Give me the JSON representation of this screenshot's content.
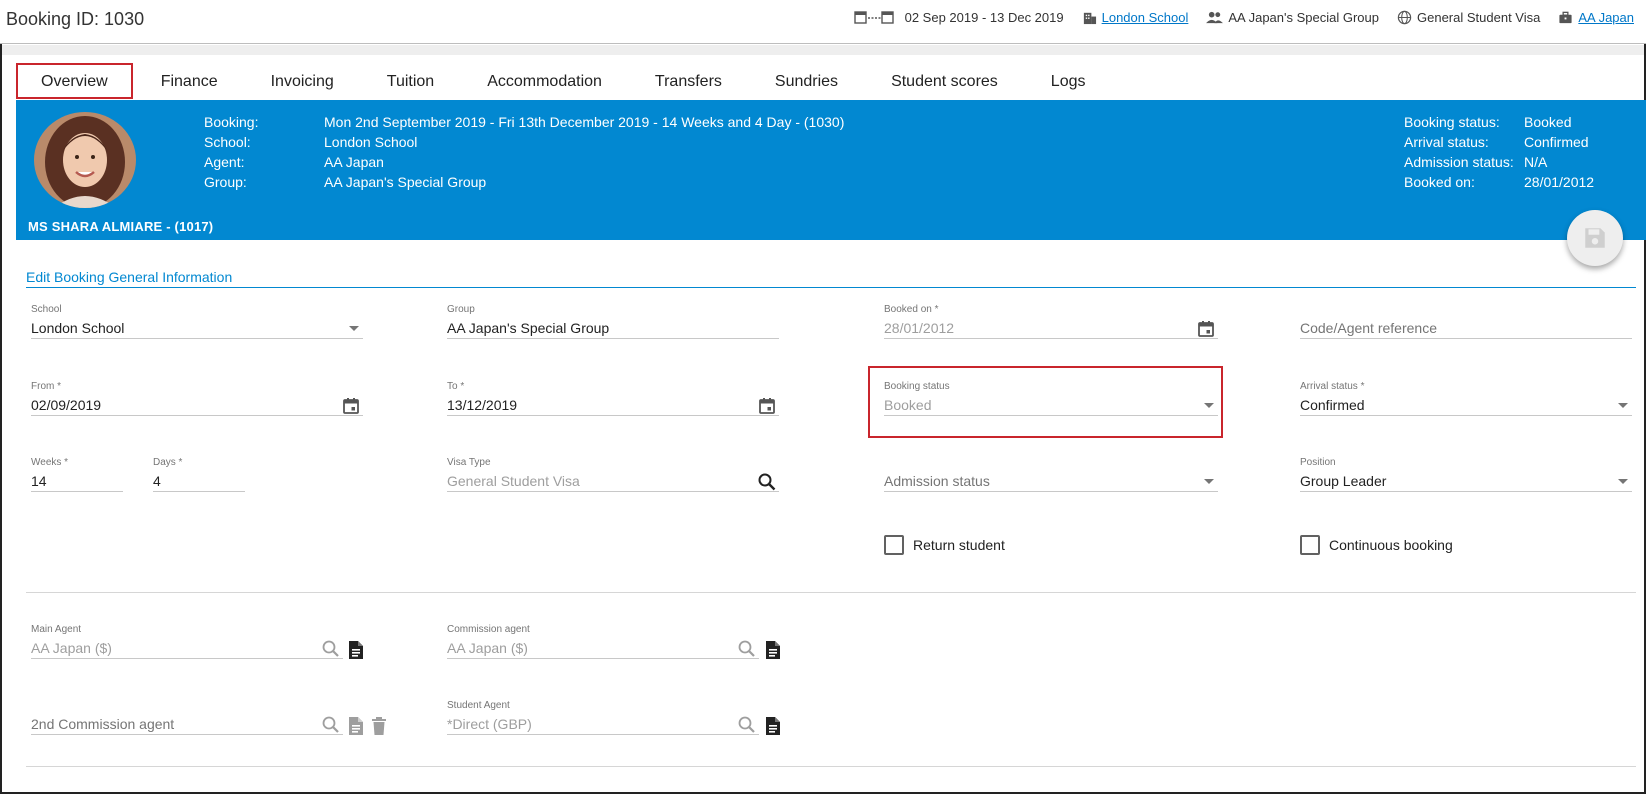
{
  "header": {
    "booking_id": "Booking ID: 1030",
    "date_range": "02 Sep 2019 - 13 Dec 2019",
    "school": "London School",
    "group": "AA Japan's Special Group",
    "visa": "General Student Visa",
    "agent": "AA Japan"
  },
  "tabs": [
    {
      "label": "Overview"
    },
    {
      "label": "Finance"
    },
    {
      "label": "Invoicing"
    },
    {
      "label": "Tuition"
    },
    {
      "label": "Accommodation"
    },
    {
      "label": "Transfers"
    },
    {
      "label": "Sundries"
    },
    {
      "label": "Student scores"
    },
    {
      "label": "Logs"
    }
  ],
  "profile": {
    "name": "MS SHARA ALMIARE - (1017)",
    "info": [
      {
        "k": "Booking:",
        "v": "Mon 2nd September 2019 - Fri 13th December 2019 - 14 Weeks and 4 Day - (1030)"
      },
      {
        "k": "School:",
        "v": "London School"
      },
      {
        "k": "Agent:",
        "v": "AA Japan"
      },
      {
        "k": "Group:",
        "v": "AA Japan's Special Group"
      }
    ],
    "status": [
      {
        "k": "Booking status:",
        "v": "Booked"
      },
      {
        "k": "Arrival status:",
        "v": "Confirmed"
      },
      {
        "k": "Admission status:",
        "v": "N/A"
      },
      {
        "k": "Booked on:",
        "v": "28/01/2012"
      }
    ]
  },
  "section": {
    "title": "Edit Booking General Information"
  },
  "form": {
    "school": {
      "label": "School",
      "value": "London School"
    },
    "group": {
      "label": "Group",
      "value": "AA Japan's Special Group"
    },
    "booked_on": {
      "label": "Booked on *",
      "value": "28/01/2012"
    },
    "code_agent_ref": {
      "placeholder": "Code/Agent reference"
    },
    "from": {
      "label": "From *",
      "value": "02/09/2019"
    },
    "to": {
      "label": "To *",
      "value": "13/12/2019"
    },
    "booking_status": {
      "label": "Booking status",
      "value": "Booked"
    },
    "arrival_status": {
      "label": "Arrival status *",
      "value": "Confirmed"
    },
    "weeks": {
      "label": "Weeks *",
      "value": "14"
    },
    "days": {
      "label": "Days *",
      "value": "4"
    },
    "visa_type": {
      "label": "Visa Type",
      "value": "General Student Visa"
    },
    "admission_status": {
      "placeholder": "Admission status"
    },
    "position": {
      "label": "Position",
      "value": "Group Leader"
    },
    "return_student": {
      "label": "Return student"
    },
    "continuous_booking": {
      "label": "Continuous booking"
    },
    "main_agent": {
      "label": "Main Agent",
      "value": "AA Japan ($)"
    },
    "commission_agent": {
      "label": "Commission agent",
      "value": "AA Japan ($)"
    },
    "second_commission_agent": {
      "placeholder": "2nd Commission agent"
    },
    "student_agent": {
      "label": "Student Agent",
      "value": "*Direct (GBP)"
    }
  }
}
